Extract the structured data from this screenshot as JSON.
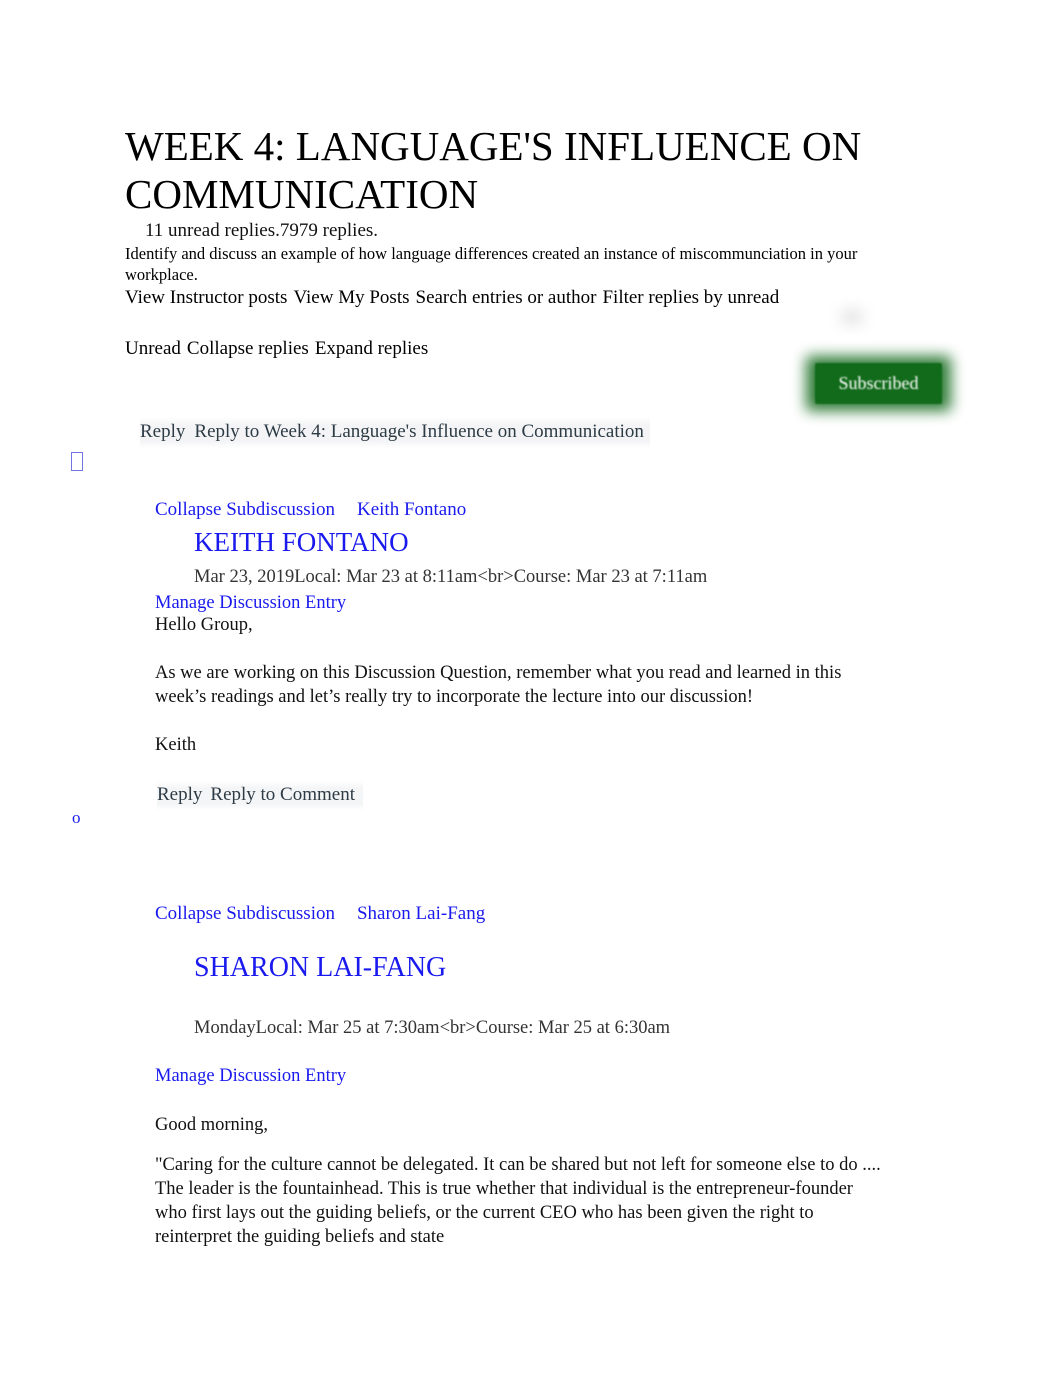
{
  "document": {
    "title": "WEEK 4: LANGUAGE'S INFLUENCE ON COMMUNICATION",
    "unread_prefix": "11 unread replies.",
    "reply_count": "7979",
    "unread_suffix": " replies.",
    "prompt": "Identify and discuss an example of how language differences created an instance of miscommunciation in your workplace."
  },
  "toolbar": {
    "view_instructor_posts": "View Instructor posts",
    "view_my_posts": "View My Posts",
    "search_entries": "Search entries or author",
    "filter_replies": "Filter replies by unread",
    "unread": "Unread",
    "collapse_replies": "Collapse replies",
    "expand_replies": "Expand replies",
    "subscribed_label": "Subscribed",
    "subscribed_color": "#126b1b"
  },
  "root_reply": {
    "reply_label": "Reply",
    "reply_to_label": "Reply to Week 4: Language's Influence on Communication"
  },
  "bullets": {
    "tofu": "",
    "circle": "o"
  },
  "entries": [
    {
      "collapse_label": "Collapse Subdiscussion",
      "author_link": "Keith Fontano",
      "author_heading": "KEITH FONTANO",
      "timestamp": "Mar 23, 2019Local: Mar 23 at 8:11am<br>Course: Mar 23 at 7:11am",
      "manage_label": "Manage Discussion Entry",
      "body": [
        "Hello Group,",
        "",
        "As we are working on this Discussion Question, remember what you read and learned in this week’s readings and let’s really try to incorporate the lecture into our discussion!",
        "",
        "Keith"
      ],
      "reply_label": "Reply",
      "reply_to_label": "Reply to Comment"
    },
    {
      "collapse_label": "Collapse Subdiscussion",
      "author_link": "Sharon Lai-Fang",
      "author_heading": "SHARON LAI-FANG",
      "timestamp": "MondayLocal: Mar 25 at 7:30am<br>Course: Mar 25 at 6:30am",
      "manage_label": "Manage Discussion Entry",
      "body": [
        "Good morning,",
        "\"Caring for the culture cannot be delegated. It can be shared but not left for someone else to do    .... The leader is the fountainhead. This is true whether that individual is the entrepreneur-founder who first lays out the guiding beliefs, or the current CEO who has been given the right to reinterpret the guiding beliefs and state"
      ]
    }
  ]
}
